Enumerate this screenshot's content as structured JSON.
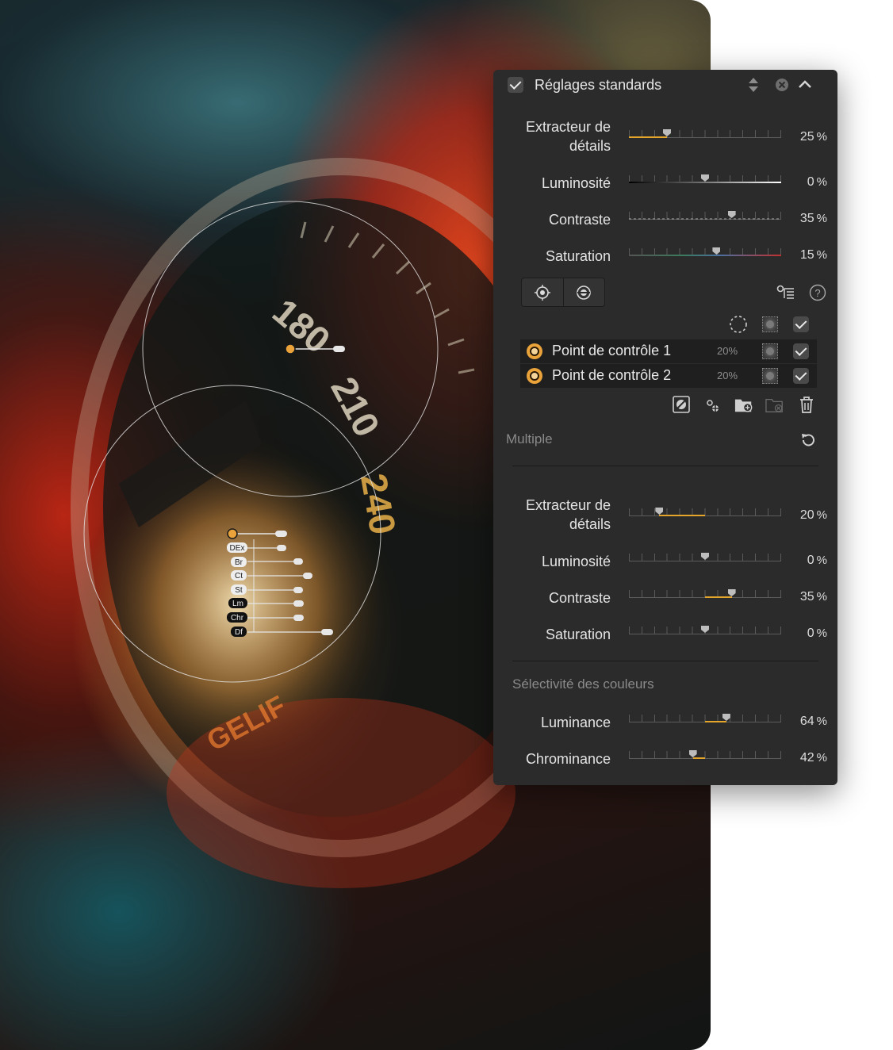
{
  "photo": {
    "dial_numbers": [
      "180",
      "210",
      "240"
    ],
    "brand_text": "GELIF",
    "tags": [
      "DEx",
      "Br",
      "Ct",
      "St",
      "Lm",
      "Chr",
      "Df"
    ]
  },
  "panel": {
    "header": {
      "title": "Réglages standards",
      "enabled": true
    },
    "global_sliders": [
      {
        "label_line1": "Extracteur de",
        "label_line2": "détails",
        "value": "25",
        "unit": "%",
        "position": 0.25
      },
      {
        "label_line1": "Luminosité",
        "label_line2": "",
        "value": "0",
        "unit": "%",
        "position": 0.5
      },
      {
        "label_line1": "Contraste",
        "label_line2": "",
        "value": "35",
        "unit": "%",
        "position": 0.675
      },
      {
        "label_line1": "Saturation",
        "label_line2": "",
        "value": "15",
        "unit": "%",
        "position": 0.575
      }
    ],
    "control_points": [
      {
        "name": "Point de contrôle 1",
        "opacity": "20%",
        "enabled": true
      },
      {
        "name": "Point de contrôle 2",
        "opacity": "20%",
        "enabled": true
      }
    ],
    "multiple_title": "Multiple",
    "local_sliders": [
      {
        "label_line1": "Extracteur de",
        "label_line2": "détails",
        "value": "20",
        "unit": "%",
        "position": 0.2
      },
      {
        "label_line1": "Luminosité",
        "label_line2": "",
        "value": "0",
        "unit": "%",
        "position": 0.5
      },
      {
        "label_line1": "Contraste",
        "label_line2": "",
        "value": "35",
        "unit": "%",
        "position": 0.675
      },
      {
        "label_line1": "Saturation",
        "label_line2": "",
        "value": "0",
        "unit": "%",
        "position": 0.5
      }
    ],
    "color_selectivity_title": "Sélectivité des couleurs",
    "color_sliders": [
      {
        "label_line1": "Luminance",
        "label_line2": "",
        "value": "64",
        "unit": "%",
        "position": 0.64
      },
      {
        "label_line1": "Chrominance",
        "label_line2": "",
        "value": "42",
        "unit": "%",
        "position": 0.42
      }
    ]
  },
  "colors": {
    "accent": "#e3a62a",
    "panel_bg": "#2b2b2b",
    "row_bg": "#1f1f1f"
  }
}
